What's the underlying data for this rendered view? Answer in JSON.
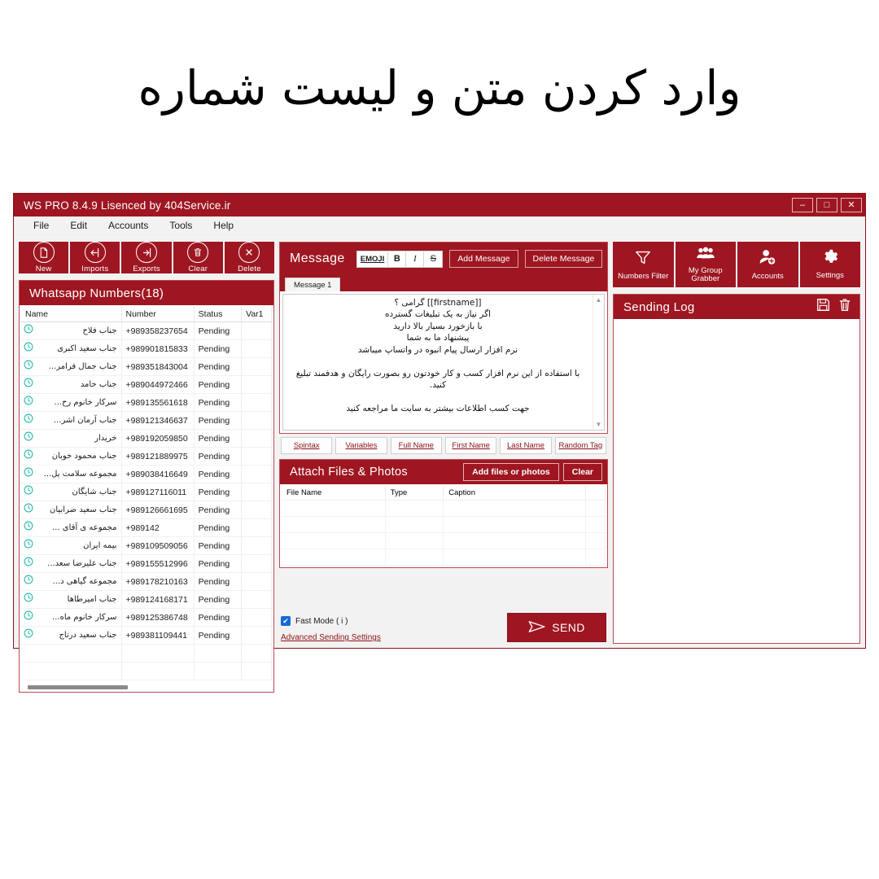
{
  "slide": {
    "headline": "وارد کردن متن و لیست شماره"
  },
  "window": {
    "title": "WS PRO 8.4.9 Lisenced by 404Service.ir",
    "controls": {
      "minimize": "–",
      "maximize": "□",
      "close": "✕"
    },
    "accent_color": "#9e1621",
    "panel_border_color": "#bb4a52"
  },
  "menubar": {
    "items": [
      "File",
      "Edit",
      "Accounts",
      "Tools",
      "Help"
    ]
  },
  "left_toolbar": {
    "buttons": [
      {
        "label": "New",
        "icon": "new-document-icon"
      },
      {
        "label": "Imports",
        "icon": "import-arrow-icon"
      },
      {
        "label": "Exports",
        "icon": "export-arrow-icon"
      },
      {
        "label": "Clear",
        "icon": "trash-icon"
      },
      {
        "label": "Delete",
        "icon": "close-x-icon"
      }
    ]
  },
  "numbers_panel": {
    "title": "Whatsapp Numbers(18)",
    "columns": [
      "Name",
      "Number",
      "Status",
      "Var1"
    ],
    "rows": [
      {
        "name": "جناب فلاح",
        "number": "+989358237654",
        "status": "Pending",
        "var1": ""
      },
      {
        "name": "جناب سعید اکبری",
        "number": "+989901815833",
        "status": "Pending",
        "var1": ""
      },
      {
        "name": "جناب جمال فرامر...",
        "number": "+989351843004",
        "status": "Pending",
        "var1": ""
      },
      {
        "name": "جناب حامد",
        "number": "+989044972466",
        "status": "Pending",
        "var1": ""
      },
      {
        "name": "سرکار خانوم رح...",
        "number": "+989135561618",
        "status": "Pending",
        "var1": ""
      },
      {
        "name": "جناب آرمان اشر...",
        "number": "+989121346637",
        "status": "Pending",
        "var1": ""
      },
      {
        "name": "خریدار",
        "number": "+989192059850",
        "status": "Pending",
        "var1": ""
      },
      {
        "name": "جناب محمود خوبان",
        "number": "+989121889975",
        "status": "Pending",
        "var1": ""
      },
      {
        "name": "مجموعه سلامت پل...",
        "number": "+989038416649",
        "status": "Pending",
        "var1": ""
      },
      {
        "name": "جناب شایگان",
        "number": "+989127116011",
        "status": "Pending",
        "var1": ""
      },
      {
        "name": "جناب سعید ضرابیان",
        "number": "+989126661695",
        "status": "Pending",
        "var1": ""
      },
      {
        "name": "مجموعه ی آقای ...",
        "number": "+989142",
        "status": "Pending",
        "var1": ""
      },
      {
        "name": "بیمه ایران",
        "number": "+989109509056",
        "status": "Pending",
        "var1": ""
      },
      {
        "name": "جناب علیرضا سعد...",
        "number": "+989155512996",
        "status": "Pending",
        "var1": ""
      },
      {
        "name": "مجموعه گیاهی د...",
        "number": "+989178210163",
        "status": "Pending",
        "var1": ""
      },
      {
        "name": "جناب امیرطاها",
        "number": "+989124168171",
        "status": "Pending",
        "var1": ""
      },
      {
        "name": "سرکار خانوم ماه...",
        "number": "+989125386748",
        "status": "Pending",
        "var1": ""
      },
      {
        "name": "جناب سعید درتاج",
        "number": "+989381109441",
        "status": "Pending",
        "var1": ""
      }
    ]
  },
  "message_panel": {
    "title": "Message",
    "format_buttons": [
      {
        "label": "EMOJI",
        "icon": "emoji-icon"
      },
      {
        "label": "B",
        "icon": "bold-icon"
      },
      {
        "label": "I",
        "icon": "italic-icon"
      },
      {
        "label": "S",
        "icon": "strikethrough-icon"
      }
    ],
    "add_message_label": "Add Message",
    "delete_message_label": "Delete Message",
    "tabs": [
      "Message 1"
    ],
    "editor_value": "[[firstname]] گرامی ؟\nاگر نیاز به یک تبلیغات گسترده\nبا بازخورد بسیار بالا دارید\nپیشنهاد ما به شما\nنرم افزار ارسال پیام انبوه در واتساپ میباشد\n\nبا استفاده از این نرم افزار کسب و کار خودتون رو بصورت رایگان و هدفمند تبلیغ کنید.\n\nجهت کسب اطلاعات بیشتر به سایت ما مراجعه کنید",
    "tag_buttons": [
      "Spintax",
      "Variables",
      "Full Name",
      "First Name",
      "Last Name",
      "Random Tag"
    ]
  },
  "attach_panel": {
    "title": "Attach Files & Photos",
    "add_label": "Add files or photos",
    "clear_label": "Clear",
    "columns": [
      "File Name",
      "Type",
      "Caption"
    ],
    "rows": []
  },
  "send_area": {
    "fast_mode_label": "Fast Mode ( i )",
    "fast_mode_checked": true,
    "advanced_link": "Advanced Sending Settings",
    "send_label": "SEND"
  },
  "right_toolbar": {
    "buttons": [
      {
        "label": "Numbers Filter",
        "icon": "funnel-filter-icon"
      },
      {
        "label": "My Group Grabber",
        "icon": "group-people-icon"
      },
      {
        "label": "Accounts",
        "icon": "user-add-icon"
      },
      {
        "label": "Settings",
        "icon": "gear-icon"
      }
    ]
  },
  "log_panel": {
    "title": "Sending Log",
    "save_icon": "save-disk-icon",
    "delete_icon": "trash-icon",
    "entries": []
  }
}
